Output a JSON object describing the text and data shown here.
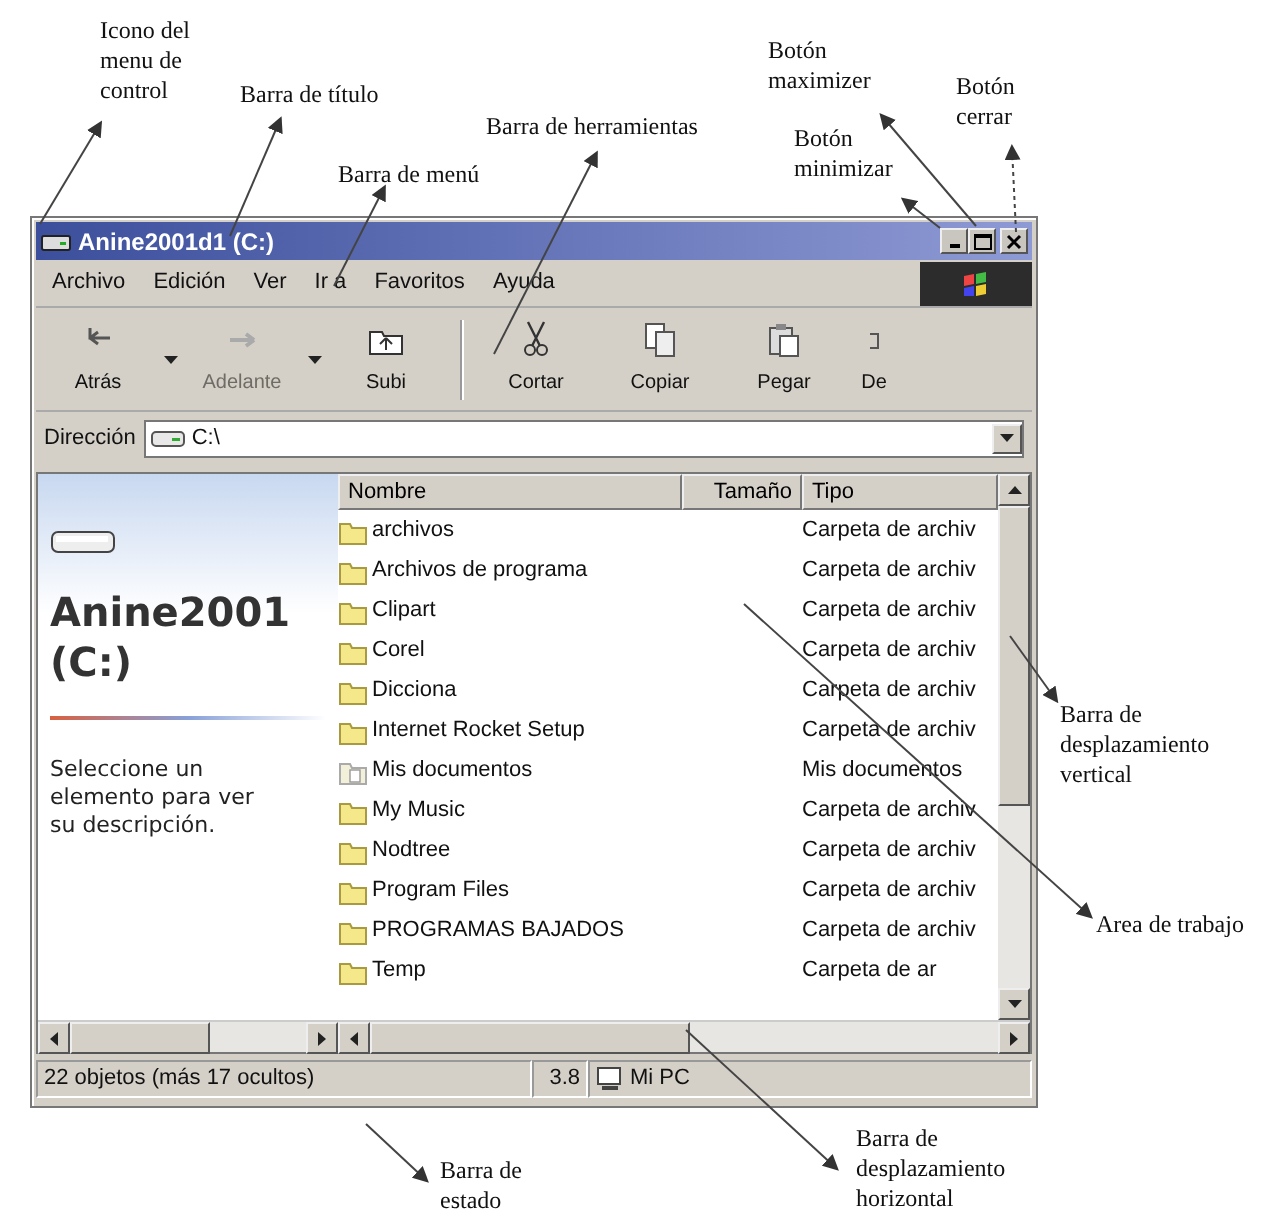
{
  "annotations": [
    {
      "lines": [
        "Icono del",
        "menu de",
        "control"
      ]
    },
    {
      "lines": [
        "Barra de título"
      ]
    },
    {
      "lines": [
        "Barra de menú"
      ]
    },
    {
      "lines": [
        "Barra de herramientas"
      ]
    },
    {
      "lines": [
        "Botón",
        "maximizer"
      ]
    },
    {
      "lines": [
        "Botón",
        "cerrar"
      ]
    },
    {
      "lines": [
        "Botón",
        "minimizar"
      ]
    },
    {
      "lines": [
        "Barra de",
        "desplazamiento",
        "vertical"
      ]
    },
    {
      "lines": [
        "Area de trabajo"
      ]
    },
    {
      "lines": [
        "Barra de",
        "estado"
      ]
    },
    {
      "lines": [
        "Barra de",
        "desplazamiento",
        "horizontal"
      ]
    }
  ],
  "window": {
    "title": "Anine2001d1 (C:)",
    "menu": [
      "Archivo",
      "Edición",
      "Ver",
      "Ir a",
      "Favoritos",
      "Ayuda"
    ],
    "toolbar": [
      {
        "label": "Atrás",
        "disabled": false,
        "caret": true
      },
      {
        "label": "Adelante",
        "disabled": true,
        "caret": true
      },
      {
        "label": "Subi",
        "disabled": false,
        "caret": false
      },
      {
        "label": "Cortar",
        "disabled": false,
        "caret": false
      },
      {
        "label": "Copiar",
        "disabled": false,
        "caret": false
      },
      {
        "label": "Pegar",
        "disabled": false,
        "caret": false
      },
      {
        "label": "De",
        "disabled": false,
        "caret": false
      }
    ],
    "address": {
      "label": "Dirección",
      "value": "C:\\"
    },
    "side_panel": {
      "title_lines": [
        "Anine2001",
        "(C:)"
      ],
      "description": "Seleccione un elemento para ver su descripción."
    },
    "table": {
      "columns": [
        "Nombre",
        "Tamaño",
        "Tipo"
      ],
      "rows": [
        {
          "name": "archivos",
          "type": "Carpeta de archiv",
          "kind": "folder"
        },
        {
          "name": "Archivos de programa",
          "type": "Carpeta de archiv",
          "kind": "folder"
        },
        {
          "name": "Clipart",
          "type": "Carpeta de archiv",
          "kind": "folder"
        },
        {
          "name": "Corel",
          "type": "Carpeta de archiv",
          "kind": "folder"
        },
        {
          "name": "Dicciona",
          "type": "Carpeta de archiv",
          "kind": "folder"
        },
        {
          "name": "Internet Rocket Setup",
          "type": "Carpeta de archiv",
          "kind": "folder"
        },
        {
          "name": "Mis documentos",
          "type": "Mis documentos",
          "kind": "documents"
        },
        {
          "name": "My Music",
          "type": "Carpeta de archiv",
          "kind": "folder"
        },
        {
          "name": "Nodtree",
          "type": "Carpeta de archiv",
          "kind": "folder"
        },
        {
          "name": "Program Files",
          "type": "Carpeta de archiv",
          "kind": "folder"
        },
        {
          "name": "PROGRAMAS BAJADOS",
          "type": "Carpeta de archiv",
          "kind": "folder"
        },
        {
          "name": "Temp",
          "type": "Carpeta de ar",
          "kind": "folder"
        }
      ]
    },
    "status_bar": {
      "objects": "22 objetos (más 17 ocultos)",
      "size": "3.8",
      "location": "Mi PC"
    }
  }
}
